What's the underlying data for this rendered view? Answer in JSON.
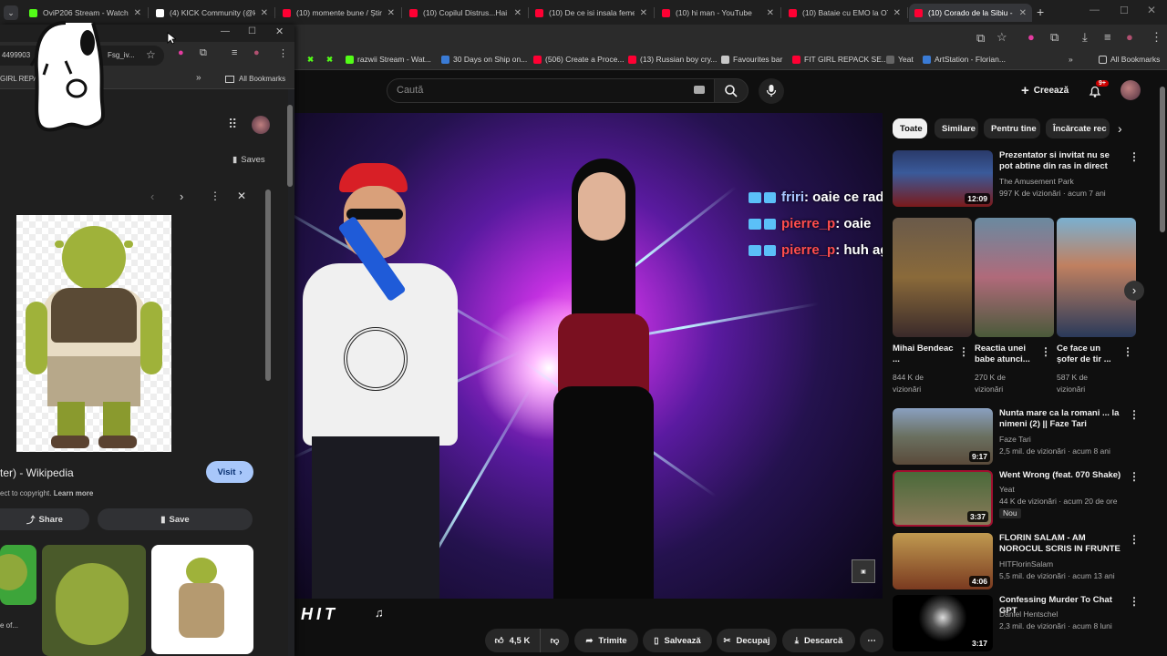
{
  "browser": {
    "tabs": [
      {
        "title": "OviP206 Stream - Watch",
        "color": "#53fc18"
      },
      {
        "title": "(4) KICK Community (@k",
        "color": "#ffffff"
      },
      {
        "title": "(10) momente bune / Știri",
        "color": "#ff0033"
      },
      {
        "title": "(10) Copilul Distrus...Hai n",
        "color": "#ff0033"
      },
      {
        "title": "(10) De ce isi insala femei",
        "color": "#ff0033"
      },
      {
        "title": "(10) hi man - YouTube",
        "color": "#ff0033"
      },
      {
        "title": "(10) Bataie cu EMO la OT",
        "color": "#ff0033"
      },
      {
        "title": "(10) Corado de la Sibiu -",
        "color": "#ff0033",
        "active": true
      }
    ],
    "new_tab": "+",
    "bookmarks": [
      {
        "label": "razwii Stream - Wat...",
        "color": "#53fc18"
      },
      {
        "label": "30 Days on Ship on...",
        "color": "#3a7bd5"
      },
      {
        "label": "(506) Create a Proce...",
        "color": "#ff0033"
      },
      {
        "label": "(13) Russian boy cry...",
        "color": "#ff0033"
      },
      {
        "label": "Favourites bar",
        "color": "#c8c8c8"
      },
      {
        "label": "FIT GIRL REPACK SE...",
        "color": "#ff0033"
      },
      {
        "label": "Yeat",
        "color": "#666"
      },
      {
        "label": "ArtStation - Florian...",
        "color": "#3a7bd5"
      }
    ],
    "all_bookmarks": "All Bookmarks"
  },
  "youtube": {
    "search_placeholder": "Caută",
    "create_label": "Creează",
    "notif_count": "9+",
    "chat": [
      {
        "user": "friri",
        "user_color": "#a9c7ff",
        "msg": ": oaie ce rad"
      },
      {
        "user": "pierre_p",
        "user_color": "#ff4d4d",
        "msg": ": oaie"
      },
      {
        "user": "pierre_p",
        "user_color": "#ff4d4d",
        "msg": ": huh agwek"
      }
    ],
    "video_watermark": "HIT",
    "actions": {
      "likes": "4,5 K",
      "share": "Trimite",
      "save": "Salvează",
      "clip": "Decupaj",
      "download": "Descarcă"
    },
    "chips": [
      "Toate",
      "Similare",
      "Pentru tine",
      "Încărcate rec"
    ],
    "recs": [
      {
        "title": "Prezentator si invitat nu se pot abtine din ras in direct",
        "channel": "The Amusement Park",
        "meta": "997 K de vizionări · acum 7 ani",
        "duration": "12:09"
      },
      {
        "title": "Nunta mare ca la romani ... la nimeni (2) || Faze Tari",
        "channel": "Faze Tari",
        "meta": "2,5 mil. de vizionări · acum 8 ani",
        "duration": "9:17"
      },
      {
        "title": "Went Wrong (feat. 070 Shake)",
        "channel": "Yeat",
        "meta": "44 K de vizionări · acum 20 de ore",
        "duration": "3:37",
        "badge": "Nou"
      },
      {
        "title": "FLORIN SALAM - AM NOROCUL SCRIS IN FRUNTE",
        "channel": "HITFlorinSalam",
        "meta": "5,5 mil. de vizionări · acum 13 ani",
        "duration": "4:06"
      },
      {
        "title": "Confessing Murder To Chat GPT",
        "channel": "Daniel Hentschel",
        "meta": "2,3 mil. de vizionări · acum 8 luni",
        "duration": "3:17"
      }
    ],
    "shorts": [
      {
        "title": "Mihai Bendeac ...",
        "views": "844 K de",
        "views2": "vizionări"
      },
      {
        "title": "Reactia unei babe atunci...",
        "views": "270 K de",
        "views2": "vizionări"
      },
      {
        "title": "Ce face un șofer de tir ...",
        "views": "587 K de",
        "views2": "vizionări"
      }
    ]
  },
  "side_window": {
    "url_fragment": "4499903",
    "url_fragment2": "Fsg_iv...",
    "bookmark": "GIRL REPACK",
    "all_bookmarks": "All Bookmarks",
    "saves": "Saves",
    "result_title": "ter) - Wikipedia",
    "visit": "Visit",
    "copyright": "ect to copyright.",
    "learn_more": "Learn more",
    "share": "Share",
    "save": "Save",
    "caption": "e of..."
  }
}
